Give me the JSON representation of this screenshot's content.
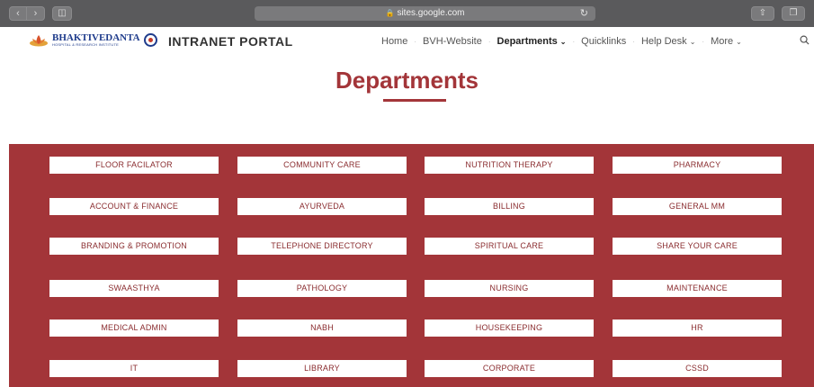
{
  "browser": {
    "url": "sites.google.com"
  },
  "header": {
    "logo_text": "BHAKTIVEDANTA",
    "logo_sub": "HOSPITAL & RESEARCH INSTITUTE",
    "title": "INTRANET PORTAL",
    "nav": [
      {
        "label": "Home",
        "dropdown": false,
        "active": false
      },
      {
        "label": "BVH-Website",
        "dropdown": false,
        "active": false
      },
      {
        "label": "Departments",
        "dropdown": true,
        "active": true
      },
      {
        "label": "Quicklinks",
        "dropdown": false,
        "active": false
      },
      {
        "label": "Help Desk",
        "dropdown": true,
        "active": false
      },
      {
        "label": "More",
        "dropdown": true,
        "active": false
      }
    ]
  },
  "hero": {
    "title": "Departments"
  },
  "colors": {
    "accent": "#a33539"
  },
  "departments": [
    "FLOOR FACILATOR",
    "COMMUNITY CARE",
    "NUTRITION THERAPY",
    "PHARMACY",
    "ACCOUNT & FINANCE",
    "AYURVEDA",
    "BILLING",
    "GENERAL MM",
    "BRANDING & PROMOTION",
    "TELEPHONE DIRECTORY",
    "SPIRITUAL CARE",
    "SHARE YOUR CARE",
    "SWAASTHYA",
    "PATHOLOGY",
    "NURSING",
    "MAINTENANCE",
    "MEDICAL ADMIN",
    "NABH",
    "HOUSEKEEPING",
    "HR",
    "IT",
    "LIBRARY",
    "CORPORATE",
    "CSSD"
  ]
}
